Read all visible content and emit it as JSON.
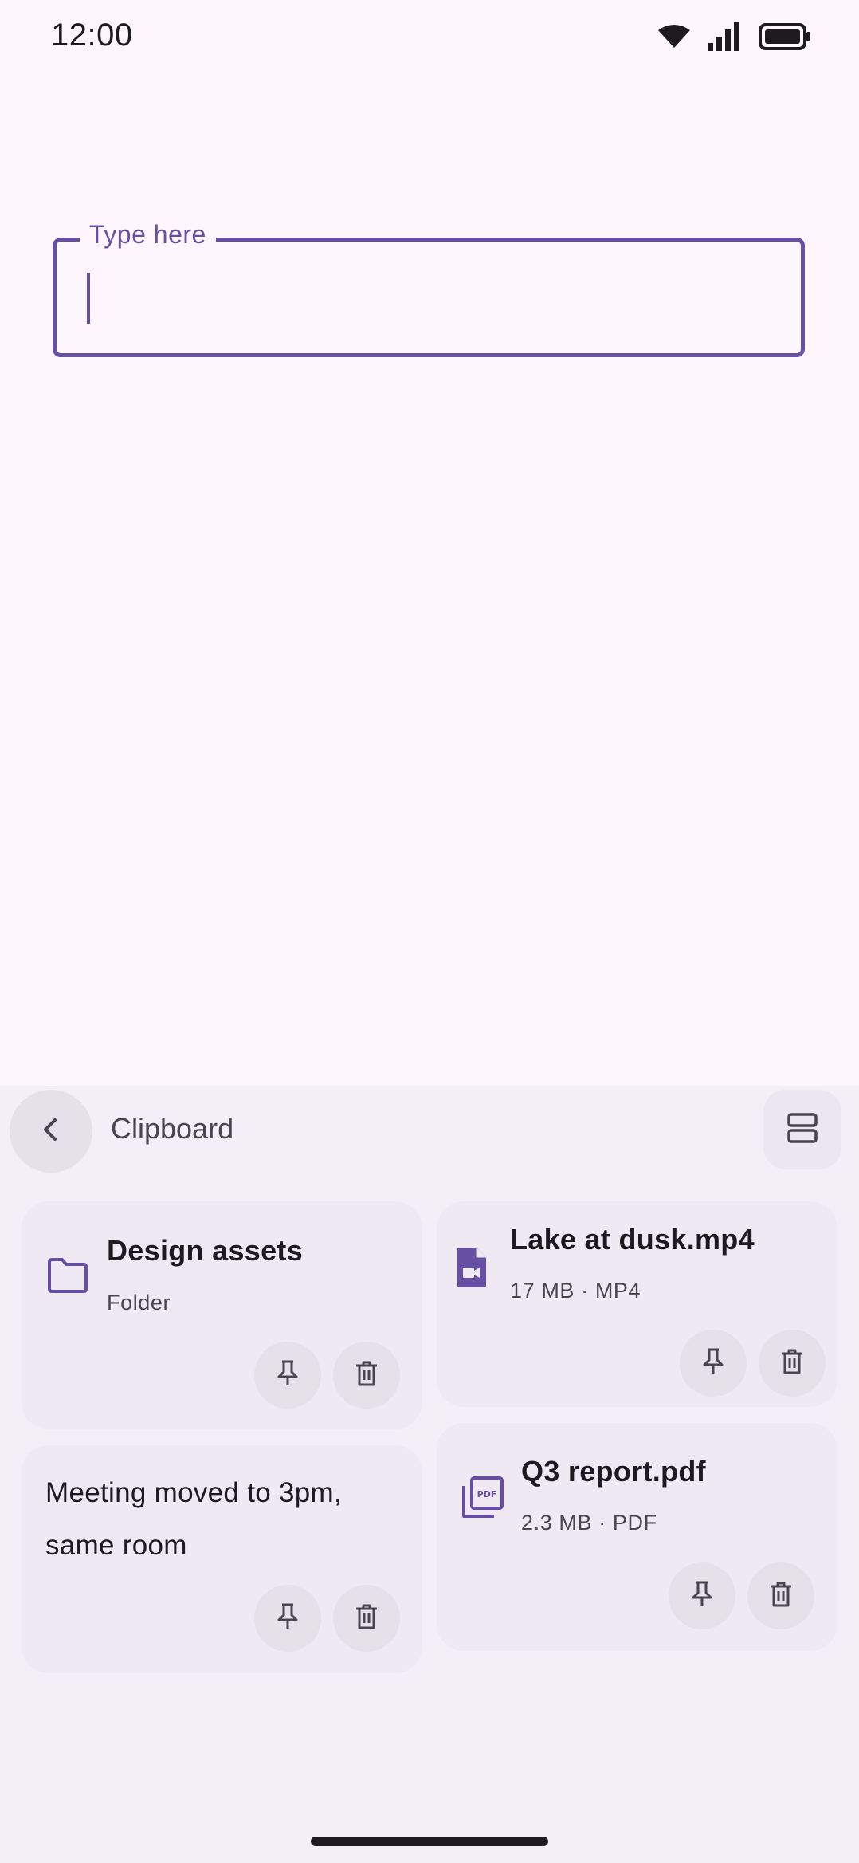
{
  "status_bar": {
    "time": "12:00",
    "icons": [
      "wifi-icon",
      "cellular-signal-icon",
      "battery-icon"
    ]
  },
  "text_field": {
    "label": "Type here",
    "value": ""
  },
  "clipboard": {
    "title": "Clipboard",
    "back_icon": "chevron-left-icon",
    "layout_icon": "view-agenda-icon",
    "items": [
      {
        "kind": "folder",
        "icon": "folder-icon",
        "title": "Design assets",
        "subtitle": "Folder"
      },
      {
        "kind": "video",
        "icon": "video-file-icon",
        "title": "Lake at dusk.mp4",
        "subtitle": "17 MB · MP4"
      },
      {
        "kind": "text",
        "text": "Meeting moved to 3pm, same room"
      },
      {
        "kind": "pdf",
        "icon": "pdf-icon",
        "title": "Q3 report.pdf",
        "subtitle": "2.3 MB · PDF"
      }
    ],
    "item_actions": [
      "pin-icon",
      "delete-icon"
    ]
  },
  "colors": {
    "accent": "#6750a4",
    "background": "#fdf7fd",
    "panel": "#f4eff6",
    "card": "#efe9f3",
    "button": "#e6e0e9"
  }
}
